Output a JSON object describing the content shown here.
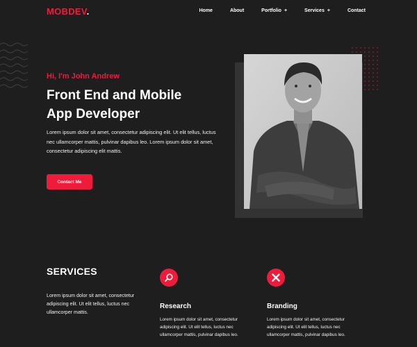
{
  "header": {
    "logo_text": "MOBDEV",
    "logo_dot": ".",
    "nav": [
      {
        "label": "Home"
      },
      {
        "label": "About"
      },
      {
        "label": "Portfolio",
        "expandable": true
      },
      {
        "label": "Services",
        "expandable": true
      },
      {
        "label": "Contact"
      }
    ]
  },
  "hero": {
    "greeting": "Hi, I'm John Andrew",
    "headline_line1": "Front End and Mobile",
    "headline_line2": "App Developer",
    "intro": "Lorem ipsum dolor sit amet, consectetur adipiscing elit. Ut elit tellus, luctus nec ullamcorper mattis, pulvinar dapibus leo. Lorem ipsum dolor sit amet, consectetur adipiscing elit mattis.",
    "cta_label": "Contact Me"
  },
  "services": {
    "title": "SERVICES",
    "description": "Lorem ipsum dolor sit amet, consectetur adipiscing elit. Ut elit tellus, luctus nec ullamcorper mattis.",
    "items": [
      {
        "title": "Research",
        "icon": "magnifier-icon",
        "description": "Lorem ipsum dolor sit amet, consectetur adipiscing elit. Ut elit tellus, luctus nec ullamcorper mattis, pulvinar dapibus leo."
      },
      {
        "title": "Branding",
        "icon": "pencil-ruler-icon",
        "description": "Lorem ipsum dolor sit amet, consectetur adipiscing elit. Ut elit tellus, luctus nec ullamcorper mattis, pulvinar dapibus leo."
      }
    ]
  },
  "colors": {
    "accent": "#ee1c3b",
    "background": "#1e1e1e",
    "photo_backdrop": "#333333"
  }
}
